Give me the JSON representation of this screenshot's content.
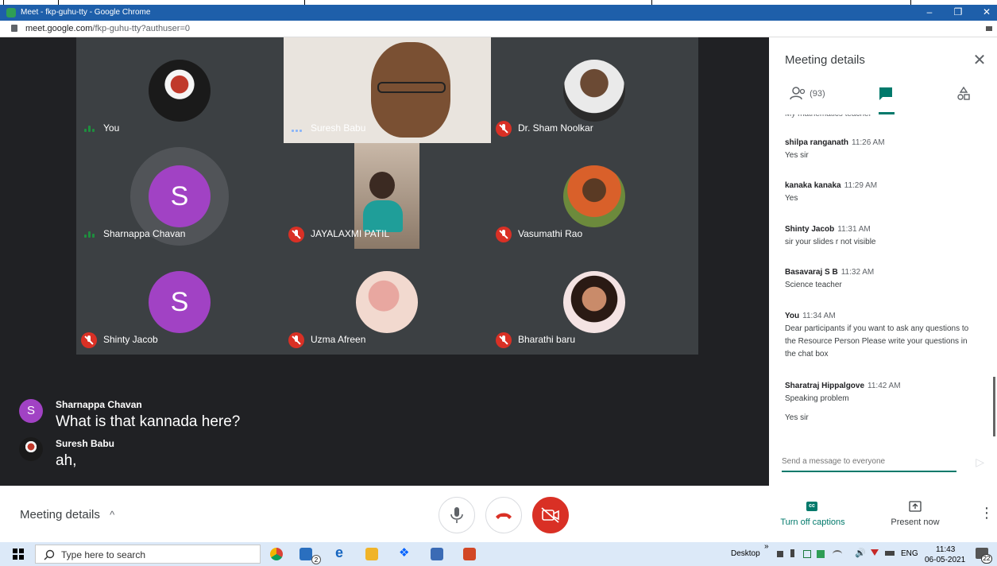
{
  "browser": {
    "title": "Meet - fkp-guhu-tty - Google Chrome",
    "url_host": "meet.google.com",
    "url_path": "/fkp-guhu-tty?authuser=0",
    "minimize_glyph": "–",
    "restore_glyph": "❐",
    "close_glyph": "✕"
  },
  "participants": [
    {
      "name": "You",
      "avatar": "photo-icon",
      "muted": false,
      "speaking": true
    },
    {
      "name": "Suresh Babu",
      "avatar": "video",
      "muted": false,
      "speaking": true
    },
    {
      "name": "Dr. Sham Noolkar",
      "avatar": "photo-icon",
      "muted": true
    },
    {
      "name": "Sharnappa Chavan",
      "avatar_letter": "S",
      "muted": false,
      "speaking": true
    },
    {
      "name": "JAYALAXMI PATIL",
      "avatar": "video",
      "muted": true
    },
    {
      "name": "Vasumathi Rao",
      "avatar": "photo-icon",
      "muted": true
    },
    {
      "name": "Shinty Jacob",
      "avatar_letter": "S",
      "muted": true
    },
    {
      "name": "Uzma Afreen",
      "avatar": "photo-icon",
      "muted": true
    },
    {
      "name": "Bharathi baru",
      "avatar": "photo-icon",
      "muted": true
    }
  ],
  "captions": [
    {
      "name": "Sharnappa Chavan",
      "avatar_letter": "S",
      "text": "What is that kannada here?"
    },
    {
      "name": "Suresh Babu",
      "text": "ah,"
    }
  ],
  "panel": {
    "title": "Meeting details",
    "close_glyph": "✕",
    "people_count": "(93)",
    "truncated_line": "My mathematics teacher",
    "messages": [
      {
        "sender": "shilpa ranganath",
        "time": "11:26 AM",
        "body": "Yes sir"
      },
      {
        "sender": "kanaka kanaka",
        "time": "11:29 AM",
        "body": "Yes"
      },
      {
        "sender": "Shinty Jacob",
        "time": "11:31 AM",
        "body": "sir your slides r not visible"
      },
      {
        "sender": "Basavaraj S B",
        "time": "11:32 AM",
        "body": "Science teacher"
      },
      {
        "sender": "You",
        "time": "11:34 AM",
        "body": "Dear participants if you want to ask any questions to the Resource Person Please write your questions in the chat box"
      },
      {
        "sender": "Sharatraj Hippalgove",
        "time": "11:42 AM",
        "body": "Speaking problem"
      }
    ],
    "extra_body": "Yes sir",
    "input_placeholder": "Send a message to everyone",
    "send_glyph": "▷"
  },
  "toolbar": {
    "meeting_details": "Meeting details",
    "chevron_glyph": "^",
    "captions_label": "Turn off captions",
    "captions_badge": "cc",
    "present_label": "Present now",
    "more_glyph": "⋮"
  },
  "taskbar": {
    "search_placeholder": "Type here to search",
    "desktop": "Desktop",
    "chevrons": "»",
    "language": "ENG",
    "time": "11:43",
    "date": "06-05-2021",
    "notifications": "22",
    "badge_count": "2"
  },
  "colors": {
    "accent": "#00796b",
    "leave_red": "#d93025",
    "avatar_purple": "#a142c4",
    "stage_bg": "#202124",
    "tile_bg": "#3c4043"
  }
}
